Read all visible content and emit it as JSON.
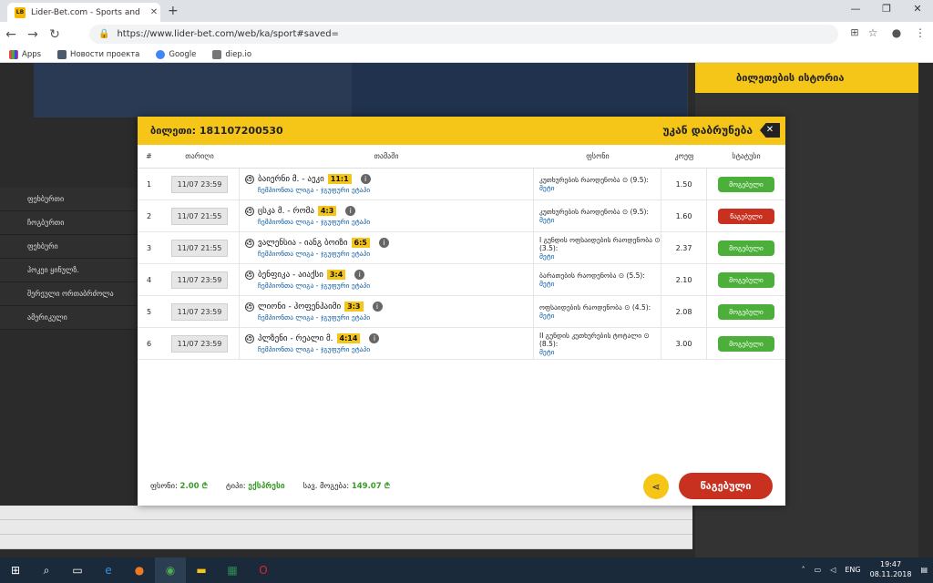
{
  "browser": {
    "tab_title": "Lider-Bet.com - Sports and Casi",
    "favicon": "LB",
    "url": "https://www.lider-bet.com/web/ka/sport#saved=",
    "bookmarks": [
      "Apps",
      "Новости проекта",
      "Google",
      "diep.io"
    ]
  },
  "site": {
    "right_header": "ბილეთების ისტორია",
    "left_items": [
      "ფეხბურთი",
      "ჩოგბურთი",
      "ფეხბური",
      "ჰოკეი ყინულზ.",
      "შერეული ორთაბრძოლა",
      "ამერიკული"
    ]
  },
  "modal": {
    "title": "ბილეთი: 181107200530",
    "back_label": "უკან დაბრუნება",
    "headers": {
      "num": "#",
      "date": "თარიღი",
      "match": "თამაში",
      "bet": "ფსონი",
      "odd": "კოეფ",
      "status": "სტატუსი"
    },
    "rows": [
      {
        "num": "1",
        "date": "11/07 23:59",
        "match": "ბაიერნი მ. - აეკი",
        "score": "11:1",
        "league": "ჩემპიონთა ლიგა - ჯგუფური ეტაპი",
        "bet": "კუთხურების რაოდენობა ⊙ (9.5):",
        "bet_sub": "მეტი",
        "odd": "1.50",
        "status": "მოგებული",
        "status_type": "win"
      },
      {
        "num": "2",
        "date": "11/07 21:55",
        "match": "ცსკა მ. - რომა",
        "score": "4:3",
        "league": "ჩემპიონთა ლიგა - ჯგუფური ეტაპი",
        "bet": "კუთხურების რაოდენობა ⊙ (9.5):",
        "bet_sub": "მეტი",
        "odd": "1.60",
        "status": "წაგებული",
        "status_type": "lose"
      },
      {
        "num": "3",
        "date": "11/07 21:55",
        "match": "ვალენსია - იანგ ბოიზი",
        "score": "6:5",
        "league": "ჩემპიონთა ლიგა - ჯგუფური ეტაპი",
        "bet": "I გუნდის ოფსაიდების რაოდენობა ⊙ (3.5):",
        "bet_sub": "მეტი",
        "odd": "2.37",
        "status": "მოგებული",
        "status_type": "win"
      },
      {
        "num": "4",
        "date": "11/07 23:59",
        "match": "ბენფიკა - აიაქსი",
        "score": "3:4",
        "league": "ჩემპიონთა ლიგა - ჯგუფური ეტაპი",
        "bet": "ბარათების რაოდენობა ⊙ (5.5):",
        "bet_sub": "მეტი",
        "odd": "2.10",
        "status": "მოგებული",
        "status_type": "win"
      },
      {
        "num": "5",
        "date": "11/07 23:59",
        "match": "ლიონი - ჰოფენჰაიმი",
        "score": "3:3",
        "league": "ჩემპიონთა ლიგა - ჯგუფური ეტაპი",
        "bet": "ოფსაიდების რაოდენობა ⊙ (4.5):",
        "bet_sub": "მეტი",
        "odd": "2.08",
        "status": "მოგებული",
        "status_type": "win"
      },
      {
        "num": "6",
        "date": "11/07 23:59",
        "match": "პლზენი - რეალი მ.",
        "score": "4:14",
        "league": "ჩემპიონთა ლიგა - ჯგუფური ეტაპი",
        "bet": "II გუნდის კუთხურების ტოტალი ⊙ (8.5):",
        "bet_sub": "მეტი",
        "odd": "3.00",
        "status": "მოგებული",
        "status_type": "win"
      }
    ],
    "footer": {
      "stake_label": "ფსონი:",
      "stake_value": "2.00 ₾",
      "type_label": "ტიპი:",
      "type_value": "ექსპრესი",
      "total_label": "სავ. მოგება:",
      "total_value": "149.07 ₾",
      "play_label": "წაგებული"
    }
  },
  "taskbar": {
    "lang": "ENG",
    "time": "19:47",
    "date": "08.11.2018"
  }
}
